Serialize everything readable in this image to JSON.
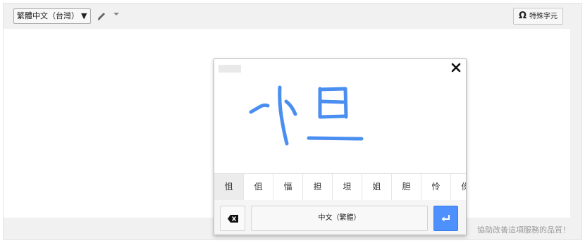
{
  "toolbar": {
    "language_label": "繁體中文（台灣）",
    "language_arrow": "▼",
    "pen_icon": "pen-icon",
    "special_chars_icon": "Ω",
    "special_chars_label": "特殊字元"
  },
  "handwriting": {
    "close_icon": "×",
    "candidates": [
      "怚",
      "伹",
      "愊",
      "担",
      "坦",
      "姐",
      "胆",
      "怜",
      "俤"
    ],
    "language_button": "中文（繁體）",
    "backspace_icon": "backspace-icon",
    "enter_icon": "enter-icon"
  },
  "footer": {
    "feedback_link": "協助改善這項服務的品質！"
  },
  "colors": {
    "ink": "#4a8ef0",
    "accent": "#4d90fe"
  }
}
